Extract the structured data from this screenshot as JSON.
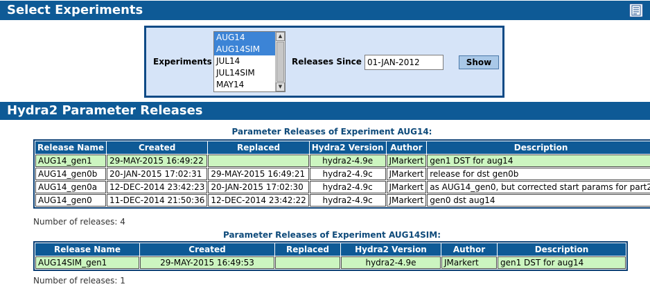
{
  "header": {
    "title": "Select Experiments"
  },
  "form": {
    "experiments_label": "Experiments",
    "experiments_options": [
      {
        "label": "AUG14",
        "selected": true
      },
      {
        "label": "AUG14SIM",
        "selected": true
      },
      {
        "label": "JUL14",
        "selected": false
      },
      {
        "label": "JUL14SIM",
        "selected": false
      },
      {
        "label": "MAY14",
        "selected": false
      }
    ],
    "releases_since_label": "Releases Since",
    "releases_since_value": "01-JAN-2012",
    "show_label": "Show"
  },
  "section": {
    "title": "Hydra2 Parameter Releases"
  },
  "tables": [
    {
      "caption": "Parameter Releases of Experiment AUG14:",
      "headers": [
        "Release Name",
        "Created",
        "Replaced",
        "Hydra2 Version",
        "Author",
        "Description"
      ],
      "rows": [
        [
          "AUG14_gen1",
          "29-MAY-2015 16:49:22",
          "",
          "hydra2-4.9e",
          "JMarkert",
          "gen1 DST for aug14"
        ],
        [
          "AUG14_gen0b",
          "20-JAN-2015 17:02:31",
          "29-MAY-2015 16:49:21",
          "hydra2-4.9c",
          "JMarkert",
          "release for dst gen0b"
        ],
        [
          "AUG14_gen0a",
          "12-DEC-2014 23:42:23",
          "20-JAN-2015 17:02:30",
          "hydra2-4.9c",
          "JMarkert",
          "as AUG14_gen0, but corrected start params for part2"
        ],
        [
          "AUG14_gen0",
          "11-DEC-2014 21:50:36",
          "12-DEC-2014 23:42:22",
          "hydra2-4.9c",
          "JMarkert",
          "gen0 dst aug14"
        ]
      ],
      "highlight_rows": [
        0
      ],
      "count_text": "Number of releases: 4"
    },
    {
      "caption": "Parameter Releases of Experiment AUG14SIM:",
      "headers": [
        "Release Name",
        "Created",
        "Replaced",
        "Hydra2 Version",
        "Author",
        "Description"
      ],
      "rows": [
        [
          "AUG14SIM_gen1",
          "29-MAY-2015 16:49:53",
          "",
          "hydra2-4.9e",
          "JMarkert",
          "gen1 DST for aug14"
        ]
      ],
      "highlight_rows": [
        0
      ],
      "count_text": "Number of releases: 1"
    }
  ],
  "colors": {
    "header_bar": "#0e5a96",
    "panel_bg": "#d6e4f8",
    "highlight_row": "#ccf5c0",
    "caption_text": "#0e4a7a"
  },
  "icons": {
    "form_icon": "form-list-icon"
  }
}
